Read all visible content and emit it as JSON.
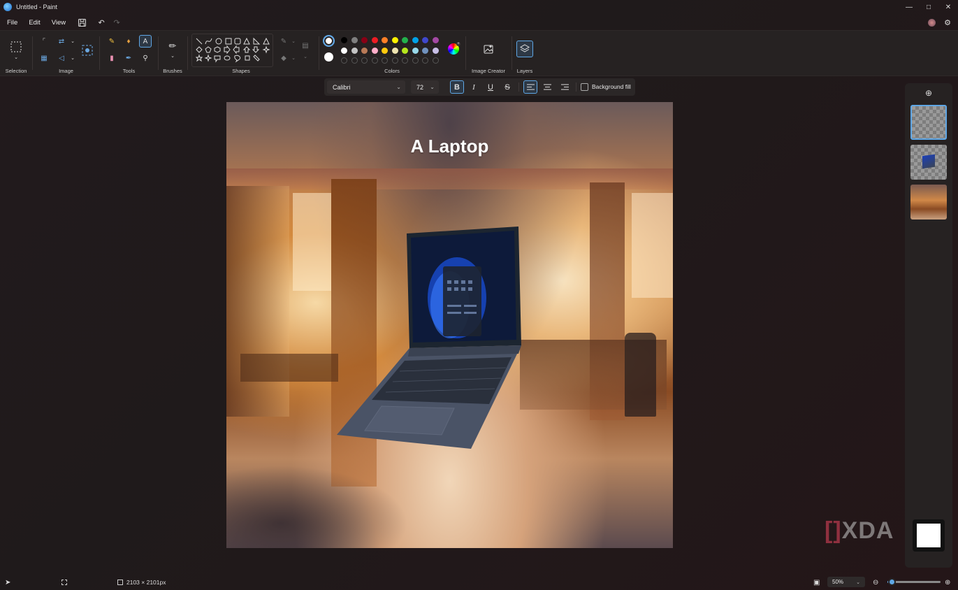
{
  "window": {
    "title": "Untitled - Paint"
  },
  "menu": {
    "file": "File",
    "edit": "Edit",
    "view": "View"
  },
  "ribbon": {
    "groups": {
      "selection": "Selection",
      "image": "Image",
      "tools": "Tools",
      "brushes": "Brushes",
      "shapes": "Shapes",
      "colors": "Colors",
      "image_creator": "Image Creator",
      "layers": "Layers"
    },
    "palette_row1": [
      "#000000",
      "#7f7f7f",
      "#880015",
      "#ed1c24",
      "#ff7f27",
      "#fff200",
      "#22b14c",
      "#00a2e8",
      "#3f48cc",
      "#a349a4"
    ],
    "palette_row2": [
      "#ffffff",
      "#c3c3c3",
      "#b97a57",
      "#ffaec9",
      "#ffc90e",
      "#efe4b0",
      "#b5e61d",
      "#99d9ea",
      "#7092be",
      "#c8bfe7"
    ],
    "color1": "#ffffff",
    "color2": "#ffffff"
  },
  "text_toolbar": {
    "font": "Calibri",
    "size": "72",
    "background_fill_label": "Background fill",
    "bold_active": true,
    "align_left_active": true
  },
  "canvas": {
    "text": "A Laptop"
  },
  "status": {
    "dimensions": "2103 × 2101px",
    "zoom": "50%",
    "zoom_fraction": 0.08
  },
  "watermark": {
    "text": "XDA"
  }
}
